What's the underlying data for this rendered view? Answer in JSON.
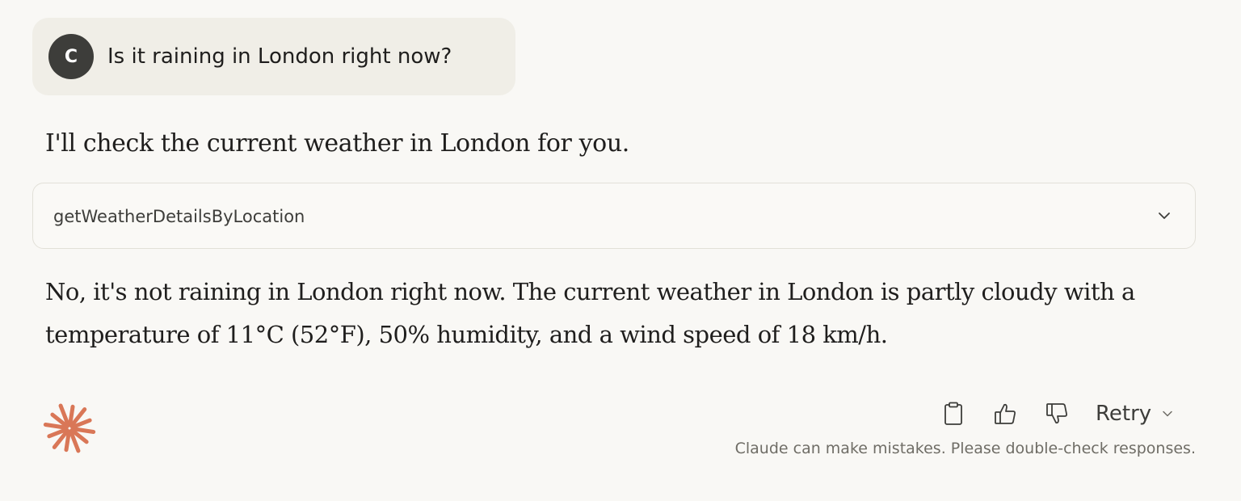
{
  "user_message": {
    "avatar_initial": "C",
    "text": "Is it raining in London right now?"
  },
  "assistant": {
    "intro": "I'll check the current weather in London for you.",
    "tool_call": {
      "name": "getWeatherDetailsByLocation",
      "chevron_icon": "chevron-down-icon"
    },
    "answer": "No, it's not raining in London right now. The current weather in London is partly cloudy with a temperature of 11°C (52°F), 50% humidity, and a wind speed of 18 km/h."
  },
  "actions": {
    "copy_icon": "clipboard-icon",
    "thumbs_up_icon": "thumbs-up-icon",
    "thumbs_down_icon": "thumbs-down-icon",
    "retry_label": "Retry",
    "retry_chevron_icon": "chevron-down-icon"
  },
  "disclaimer": "Claude can make mistakes. Please double-check responses.",
  "colors": {
    "background": "#f9f8f5",
    "user_bubble": "#f0eee7",
    "avatar": "#3d3d3a",
    "brand_orange": "#d97757",
    "text": "#1f1e1d",
    "muted_text": "#6f6d66"
  }
}
